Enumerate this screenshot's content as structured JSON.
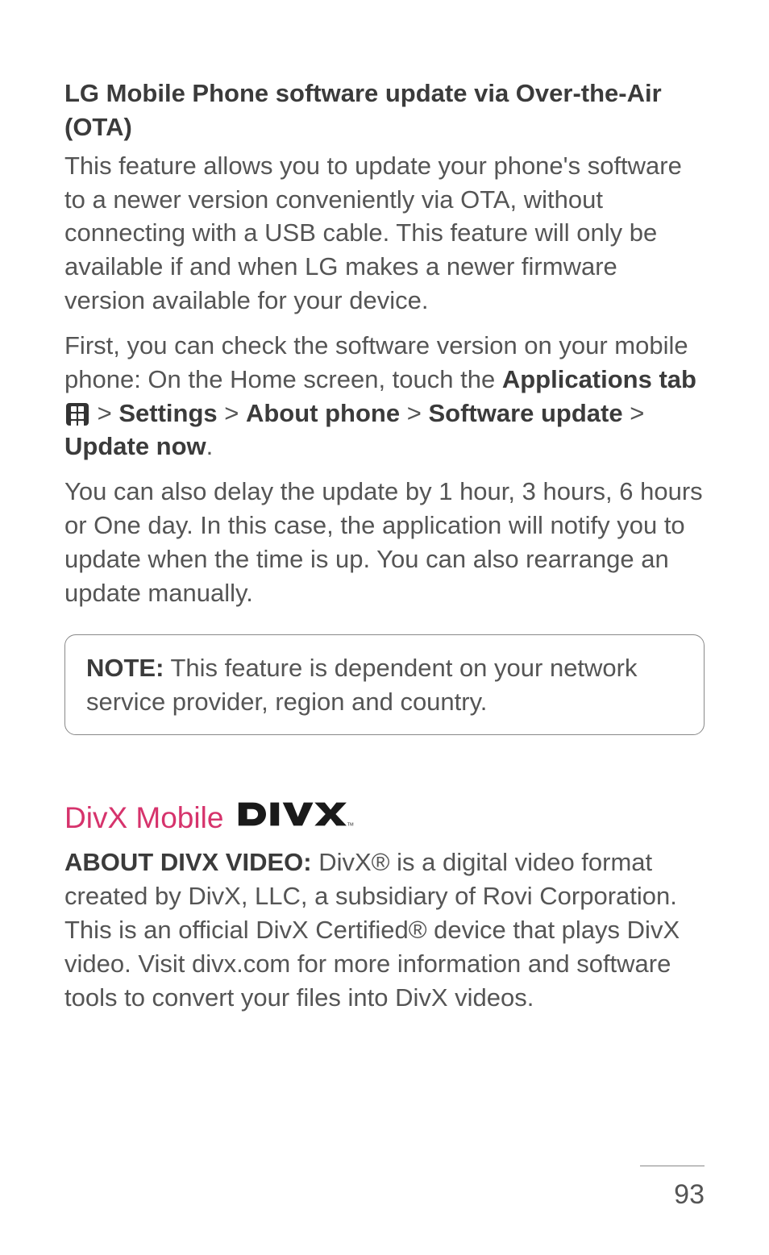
{
  "heading1": "LG Mobile Phone software update via Over-the-Air (OTA)",
  "para1": "This feature allows you to update your phone's software to a newer version conveniently via OTA, without connecting with a USB cable. This feature will only be available if and when LG makes a newer firmware version available for your device.",
  "para2_pre": "First, you can check the software version on your mobile phone: On the Home screen, touch the ",
  "para2_b1": "Applications tab",
  "para2_sep1": " > ",
  "para2_b2": "Settings",
  "para2_sep2": " > ",
  "para2_b3": "About phone",
  "para2_sep3": " > ",
  "para2_b4": "Software update",
  "para2_sep4": " > ",
  "para2_b5": "Update now",
  "para2_end": ".",
  "para3": "You can also delay the update by 1 hour, 3 hours, 6 hours or One day. In this case, the application will notify you to update when the time is up. You can also rearrange an update manually.",
  "note_label": "NOTE:",
  "note_text": " This feature is dependent on your network service provider, region and country.",
  "section_title": "DivX Mobile",
  "para4_b1": "ABOUT DIVX VIDEO:",
  "para4_text": " DivX® is a digital video format created by DivX, LLC, a subsidiary of Rovi Corporation. This is an official DivX Certified® device that plays DivX video. Visit divx.com for more information and software tools to convert your files into DivX videos.",
  "page_number": "93"
}
